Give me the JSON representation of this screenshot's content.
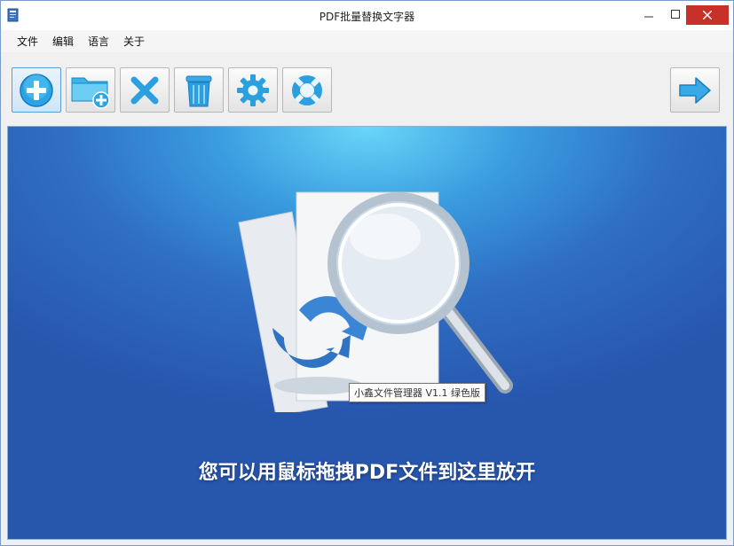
{
  "window": {
    "title": "PDF批量替换文字器"
  },
  "menu": {
    "items": [
      "文件",
      "编辑",
      "语言",
      "关于"
    ]
  },
  "toolbar": {
    "buttons": [
      {
        "name": "add-file-button",
        "icon": "plus-circle-icon"
      },
      {
        "name": "add-folder-button",
        "icon": "folder-add-icon"
      },
      {
        "name": "remove-button",
        "icon": "x-icon"
      },
      {
        "name": "clear-button",
        "icon": "trash-icon"
      },
      {
        "name": "settings-button",
        "icon": "gear-icon"
      },
      {
        "name": "help-button",
        "icon": "lifebuoy-icon"
      },
      {
        "name": "next-button",
        "icon": "arrow-right-icon"
      }
    ]
  },
  "dropzone": {
    "tooltip": "小鑫文件管理器 V1.1 绿色版",
    "hint": "您可以用鼠标拖拽PDF文件到这里放开"
  },
  "colors": {
    "accent": "#2f6fc4",
    "close": "#c7312a"
  }
}
